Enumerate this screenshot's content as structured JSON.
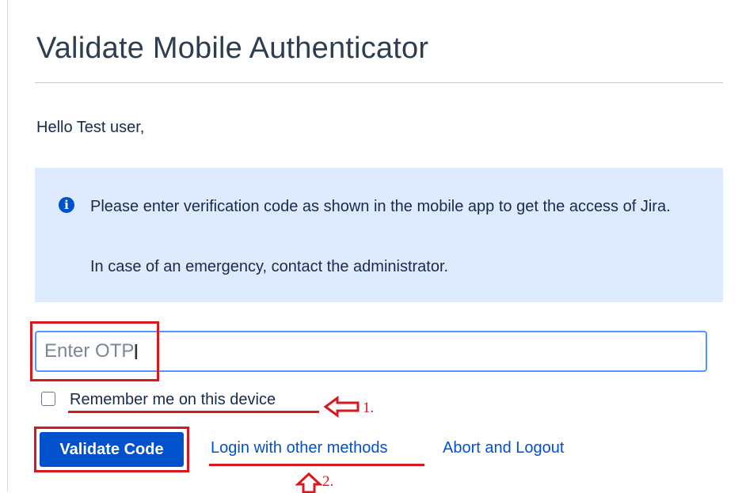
{
  "page": {
    "title": "Validate Mobile Authenticator",
    "greeting": "Hello Test user,"
  },
  "info": {
    "icon": "info-icon",
    "message": "Please enter verification code as shown in the mobile app to get the access of Jira.",
    "emergency": "In case of an emergency, contact the administrator."
  },
  "form": {
    "otp_placeholder": "Enter OTP",
    "otp_value": "",
    "remember_label": "Remember me on this device",
    "remember_checked": false,
    "validate_label": "Validate Code",
    "other_methods_label": "Login with other methods",
    "abort_label": "Abort and Logout"
  },
  "annotations": {
    "step1": "1.",
    "step2": "2.",
    "color": "#d7181f"
  },
  "colors": {
    "primary": "#0052cc",
    "info_bg": "#deebff",
    "input_focus": "#4c9aff"
  }
}
